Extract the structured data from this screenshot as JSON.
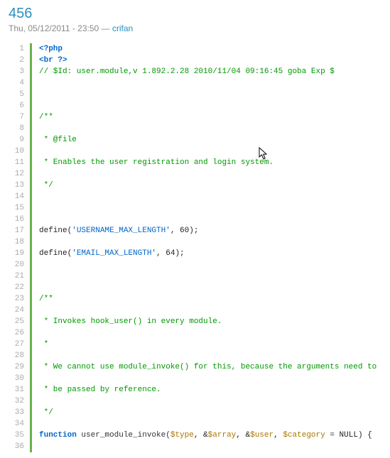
{
  "post": {
    "title": "456",
    "date": "Thu, 05/12/2011 - 23:50",
    "separator": " — ",
    "author": "crifan"
  },
  "code": {
    "lines": [
      {
        "n": 1,
        "segs": [
          {
            "t": "<?php",
            "c": "tok-kw"
          }
        ]
      },
      {
        "n": 2,
        "segs": [
          {
            "t": "<br ?>",
            "c": "tok-kw"
          }
        ]
      },
      {
        "n": 3,
        "segs": [
          {
            "t": "// $Id: user.module,v 1.892.2.28 2010/11/04 09:16:45 goba Exp $",
            "c": "tok-com"
          }
        ]
      },
      {
        "n": 4,
        "segs": []
      },
      {
        "n": 5,
        "segs": []
      },
      {
        "n": 6,
        "segs": []
      },
      {
        "n": 7,
        "segs": [
          {
            "t": "/**",
            "c": "tok-com"
          }
        ]
      },
      {
        "n": 8,
        "segs": []
      },
      {
        "n": 9,
        "segs": [
          {
            "t": " * @file",
            "c": "tok-com"
          }
        ]
      },
      {
        "n": 10,
        "segs": []
      },
      {
        "n": 11,
        "segs": [
          {
            "t": " * Enables the user registration and login system.",
            "c": "tok-com"
          }
        ]
      },
      {
        "n": 12,
        "segs": []
      },
      {
        "n": 13,
        "segs": [
          {
            "t": " */",
            "c": "tok-com"
          }
        ]
      },
      {
        "n": 14,
        "segs": []
      },
      {
        "n": 15,
        "segs": []
      },
      {
        "n": 16,
        "segs": []
      },
      {
        "n": 17,
        "segs": [
          {
            "t": "define(",
            "c": ""
          },
          {
            "t": "'USERNAME_MAX_LENGTH'",
            "c": "tok-str"
          },
          {
            "t": ", 60);",
            "c": ""
          }
        ]
      },
      {
        "n": 18,
        "segs": []
      },
      {
        "n": 19,
        "segs": [
          {
            "t": "define(",
            "c": ""
          },
          {
            "t": "'EMAIL_MAX_LENGTH'",
            "c": "tok-str"
          },
          {
            "t": ", 64);",
            "c": ""
          }
        ]
      },
      {
        "n": 20,
        "segs": []
      },
      {
        "n": 21,
        "segs": []
      },
      {
        "n": 22,
        "segs": []
      },
      {
        "n": 23,
        "segs": [
          {
            "t": "/**",
            "c": "tok-com"
          }
        ]
      },
      {
        "n": 24,
        "segs": []
      },
      {
        "n": 25,
        "segs": [
          {
            "t": " * Invokes hook_user() in every module.",
            "c": "tok-com"
          }
        ]
      },
      {
        "n": 26,
        "segs": []
      },
      {
        "n": 27,
        "segs": [
          {
            "t": " *",
            "c": "tok-com"
          }
        ]
      },
      {
        "n": 28,
        "segs": []
      },
      {
        "n": 29,
        "segs": [
          {
            "t": " * We cannot use module_invoke() for this, because the arguments need to",
            "c": "tok-com"
          }
        ]
      },
      {
        "n": 30,
        "segs": []
      },
      {
        "n": 31,
        "segs": [
          {
            "t": " * be passed by reference.",
            "c": "tok-com"
          }
        ]
      },
      {
        "n": 32,
        "segs": []
      },
      {
        "n": 33,
        "segs": [
          {
            "t": " */",
            "c": "tok-com"
          }
        ]
      },
      {
        "n": 34,
        "segs": []
      },
      {
        "n": 35,
        "segs": [
          {
            "t": "function",
            "c": "tok-kw"
          },
          {
            "t": " user_module_invoke(",
            "c": "tok-fn"
          },
          {
            "t": "$type",
            "c": "tok-var"
          },
          {
            "t": ", &",
            "c": ""
          },
          {
            "t": "$array",
            "c": "tok-var"
          },
          {
            "t": ", &",
            "c": ""
          },
          {
            "t": "$user",
            "c": "tok-var"
          },
          {
            "t": ", ",
            "c": ""
          },
          {
            "t": "$category",
            "c": "tok-var"
          },
          {
            "t": " = NULL) {",
            "c": ""
          }
        ]
      },
      {
        "n": 36,
        "segs": []
      }
    ]
  }
}
